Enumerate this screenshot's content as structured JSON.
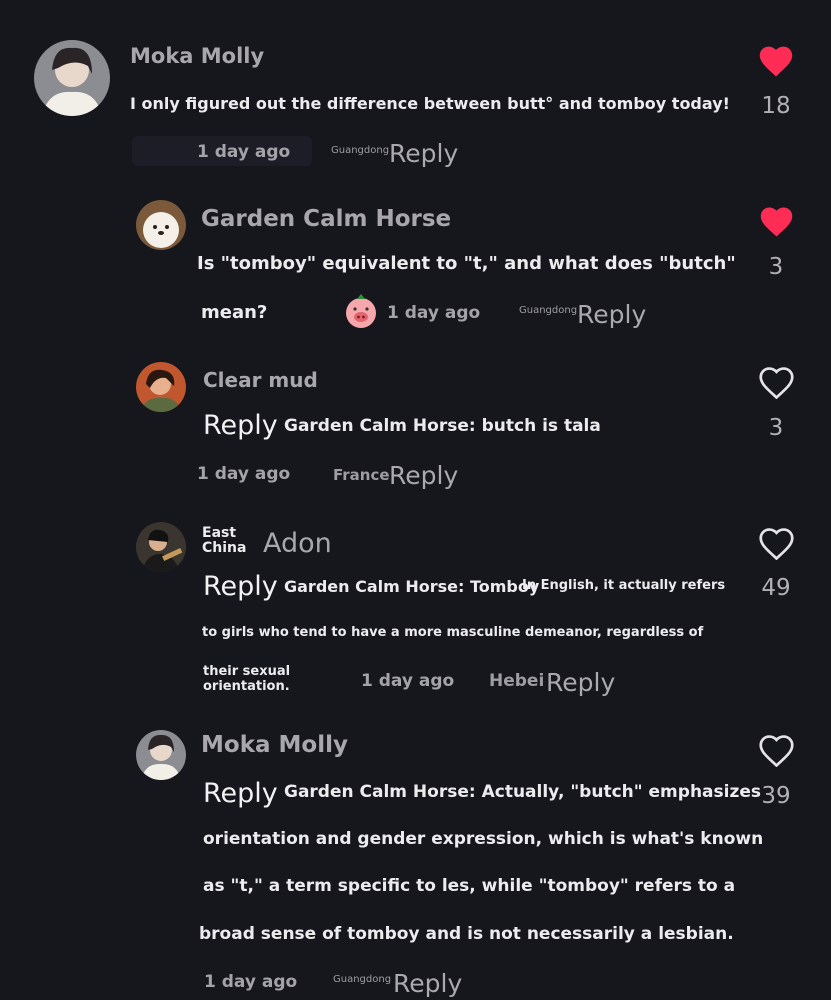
{
  "colors": {
    "background": "#16161d",
    "liked": "#ff2d55",
    "muted": "#a7a7ad",
    "text": "#ececef"
  },
  "comments": [
    {
      "user": "Moka Molly",
      "text_lines": [
        "I only figured out the difference between butt° and tomboy today!"
      ],
      "time": "1 day ago",
      "location": "Guangdong",
      "reply_label": "Reply",
      "likes": "18",
      "liked": true
    },
    {
      "user": "Garden Calm Horse",
      "text_lines": [
        "Is \"tomboy\" equivalent to \"t,\" and what does \"butch\"",
        "mean?"
      ],
      "emoji": "pig-emoji",
      "time": "1 day ago",
      "location": "Guangdong",
      "reply_label": "Reply",
      "likes": "3",
      "liked": true
    },
    {
      "user": "Clear mud",
      "reply_prefix": "Reply",
      "text_lines": [
        "Garden Calm Horse: butch is tala"
      ],
      "time": "1 day ago",
      "location": "France",
      "reply_label": "Reply",
      "likes": "3",
      "liked": false
    },
    {
      "user_location": "East China",
      "user": "Adon",
      "reply_prefix": "Reply",
      "text_lines": [
        "Garden Calm Horse: Tomboy",
        "In English, it actually refers",
        "to girls who tend to have a more masculine demeanor, regardless of",
        "their sexual",
        "orientation."
      ],
      "time": "1 day ago",
      "location": "Hebei",
      "reply_label": "Reply",
      "likes": "49",
      "liked": false
    },
    {
      "user": "Moka Molly",
      "reply_prefix": "Reply",
      "text_lines": [
        "Garden Calm Horse: Actually, \"butch\" emphasizes",
        "orientation and gender expression, which is what's known",
        "as \"t,\" a term specific to les, while \"tomboy\" refers to a",
        "broad sense of tomboy and is not necessarily a lesbian."
      ],
      "time": "1 day ago",
      "location": "Guangdong",
      "reply_label": "Reply",
      "likes": "39",
      "liked": false
    }
  ]
}
